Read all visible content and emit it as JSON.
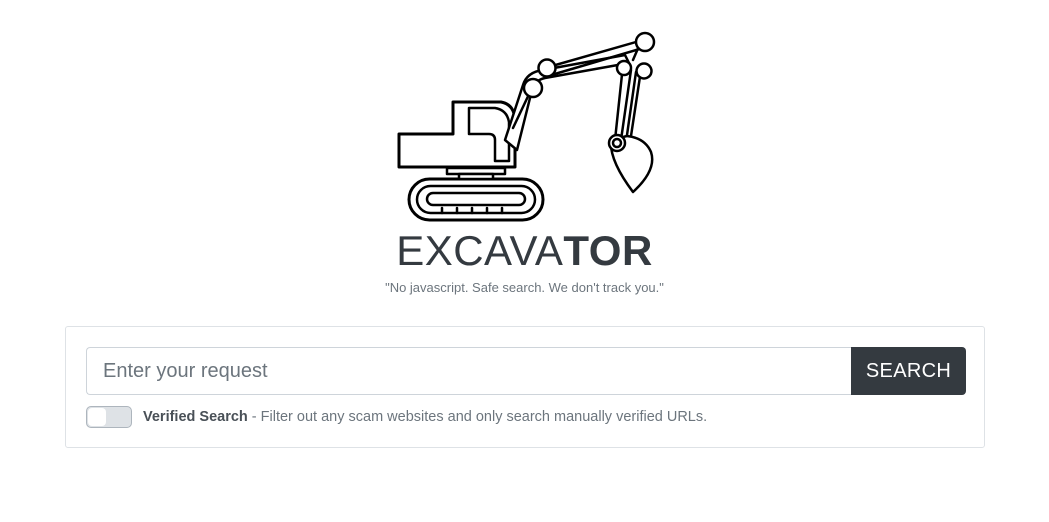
{
  "brand": {
    "name_light": "EXCAVA",
    "name_bold": "TOR",
    "tagline": "\"No javascript. Safe search. We don't track you.\"",
    "logo_icon": "excavator-icon"
  },
  "search": {
    "placeholder": "Enter your request",
    "value": "",
    "button_label": "SEARCH"
  },
  "verified_search": {
    "enabled": false,
    "label": "Verified Search",
    "description": " - Filter out any scam websites and only search manually verified URLs."
  },
  "colors": {
    "dark": "#343a40",
    "muted": "#6c757d",
    "border": "#dee2e6"
  }
}
